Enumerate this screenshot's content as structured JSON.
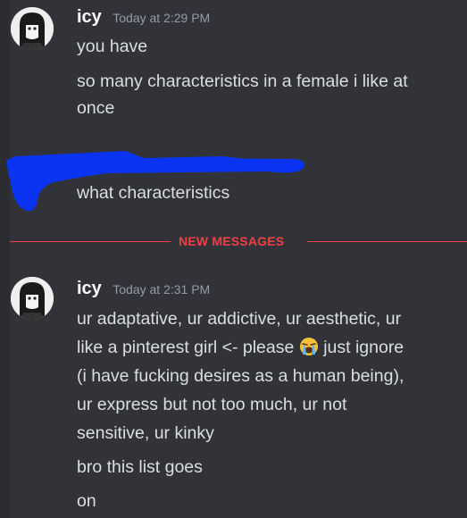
{
  "group1": {
    "username": "icy",
    "timestamp": "Today at 2:29 PM",
    "messages": [
      "you have",
      "so many characteristics in a female i like at",
      "once"
    ]
  },
  "reply": {
    "text": "what characteristics",
    "redaction_color": "#0a34f2"
  },
  "divider": {
    "label": "NEW MESSAGES",
    "color": "#f23f43"
  },
  "group2": {
    "username": "icy",
    "timestamp": "Today at 2:31 PM",
    "lines": [
      "ur adaptative, ur addictive, ur aesthetic, ur",
      "like a pinterest girl <- please",
      "just ignore",
      "(i have fucking desires as a human being),",
      "ur express but not too much, ur not",
      "sensitive, ur kinky",
      "bro this list goes",
      "on"
    ],
    "emoji": "loudly-crying-face-emoji"
  }
}
